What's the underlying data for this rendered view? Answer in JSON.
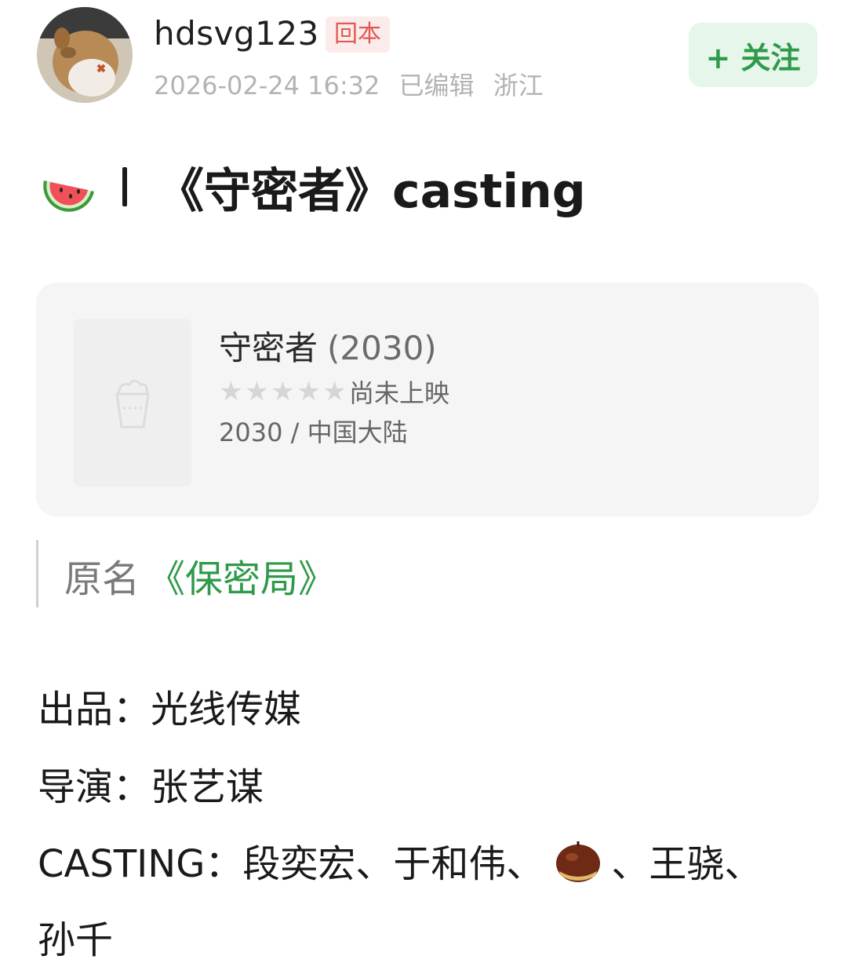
{
  "author": {
    "username": "hdsvg123",
    "badge": "回本",
    "timestamp": "2026-02-24 16:32",
    "edited": "已编辑",
    "location": "浙江",
    "follow_label": "+ 关注"
  },
  "post": {
    "title_icon": "watermelon-emoji",
    "title": "《守密者》casting"
  },
  "movie_card": {
    "title": "守密者",
    "year": "(2030)",
    "rating_stars": 0,
    "rating_text": "尚未上映",
    "info": "2030 / 中国大陆",
    "poster_icon": "popcorn-placeholder-icon"
  },
  "original_name": {
    "label": "原名",
    "link": "《保密局》"
  },
  "details": {
    "producer": "出品：光线传媒",
    "director": "导演：张艺谋",
    "casting_label": "CASTING：",
    "cast_part1": "段奕宏、于和伟、",
    "cast_icon": "chestnut-emoji",
    "cast_part2": "、王骁、",
    "cast_line2": "孙千"
  },
  "colors": {
    "accent_green": "#2f9a49",
    "badge_red": "#e05a55",
    "meta_gray": "#b3b3b3",
    "card_bg": "#f5f5f5"
  }
}
